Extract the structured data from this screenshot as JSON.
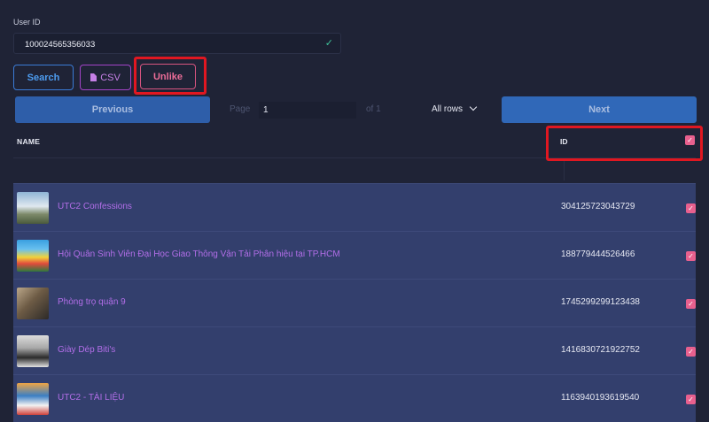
{
  "user_id": {
    "label": "User ID",
    "value": "100024565356033"
  },
  "actions": {
    "search": "Search",
    "csv": "CSV",
    "unlike": "Unlike"
  },
  "pagination": {
    "previous": "Previous",
    "next": "Next",
    "page_label": "Page",
    "page_value": "1",
    "of_label": "of 1",
    "rows_option": "All rows"
  },
  "table": {
    "headers": {
      "name": "NAME",
      "id": "ID"
    },
    "rows": [
      {
        "name": "UTC2 Confessions",
        "id": "304125723043729",
        "checked": true
      },
      {
        "name": "Hội Quân Sinh Viên Đại Học Giao Thông Vận Tải Phân hiệu tại TP.HCM",
        "id": "188779444526466",
        "checked": true
      },
      {
        "name": "Phòng trọ quận 9",
        "id": "1745299299123438",
        "checked": true
      },
      {
        "name": "Giày Dép Biti's",
        "id": "1416830721922752",
        "checked": true
      },
      {
        "name": "UTC2 - TÀI LIỆU",
        "id": "1163940193619540",
        "checked": true
      }
    ]
  },
  "colors": {
    "background": "#1f2336",
    "row": "#333f6d",
    "accent_blue": "#2e5ea9",
    "checkbox": "#e8608e",
    "highlight": "#e01721",
    "link": "#b26ee8"
  },
  "icons": {
    "valid": "check-icon",
    "csv": "document-icon",
    "checkbox": "checkmark"
  }
}
